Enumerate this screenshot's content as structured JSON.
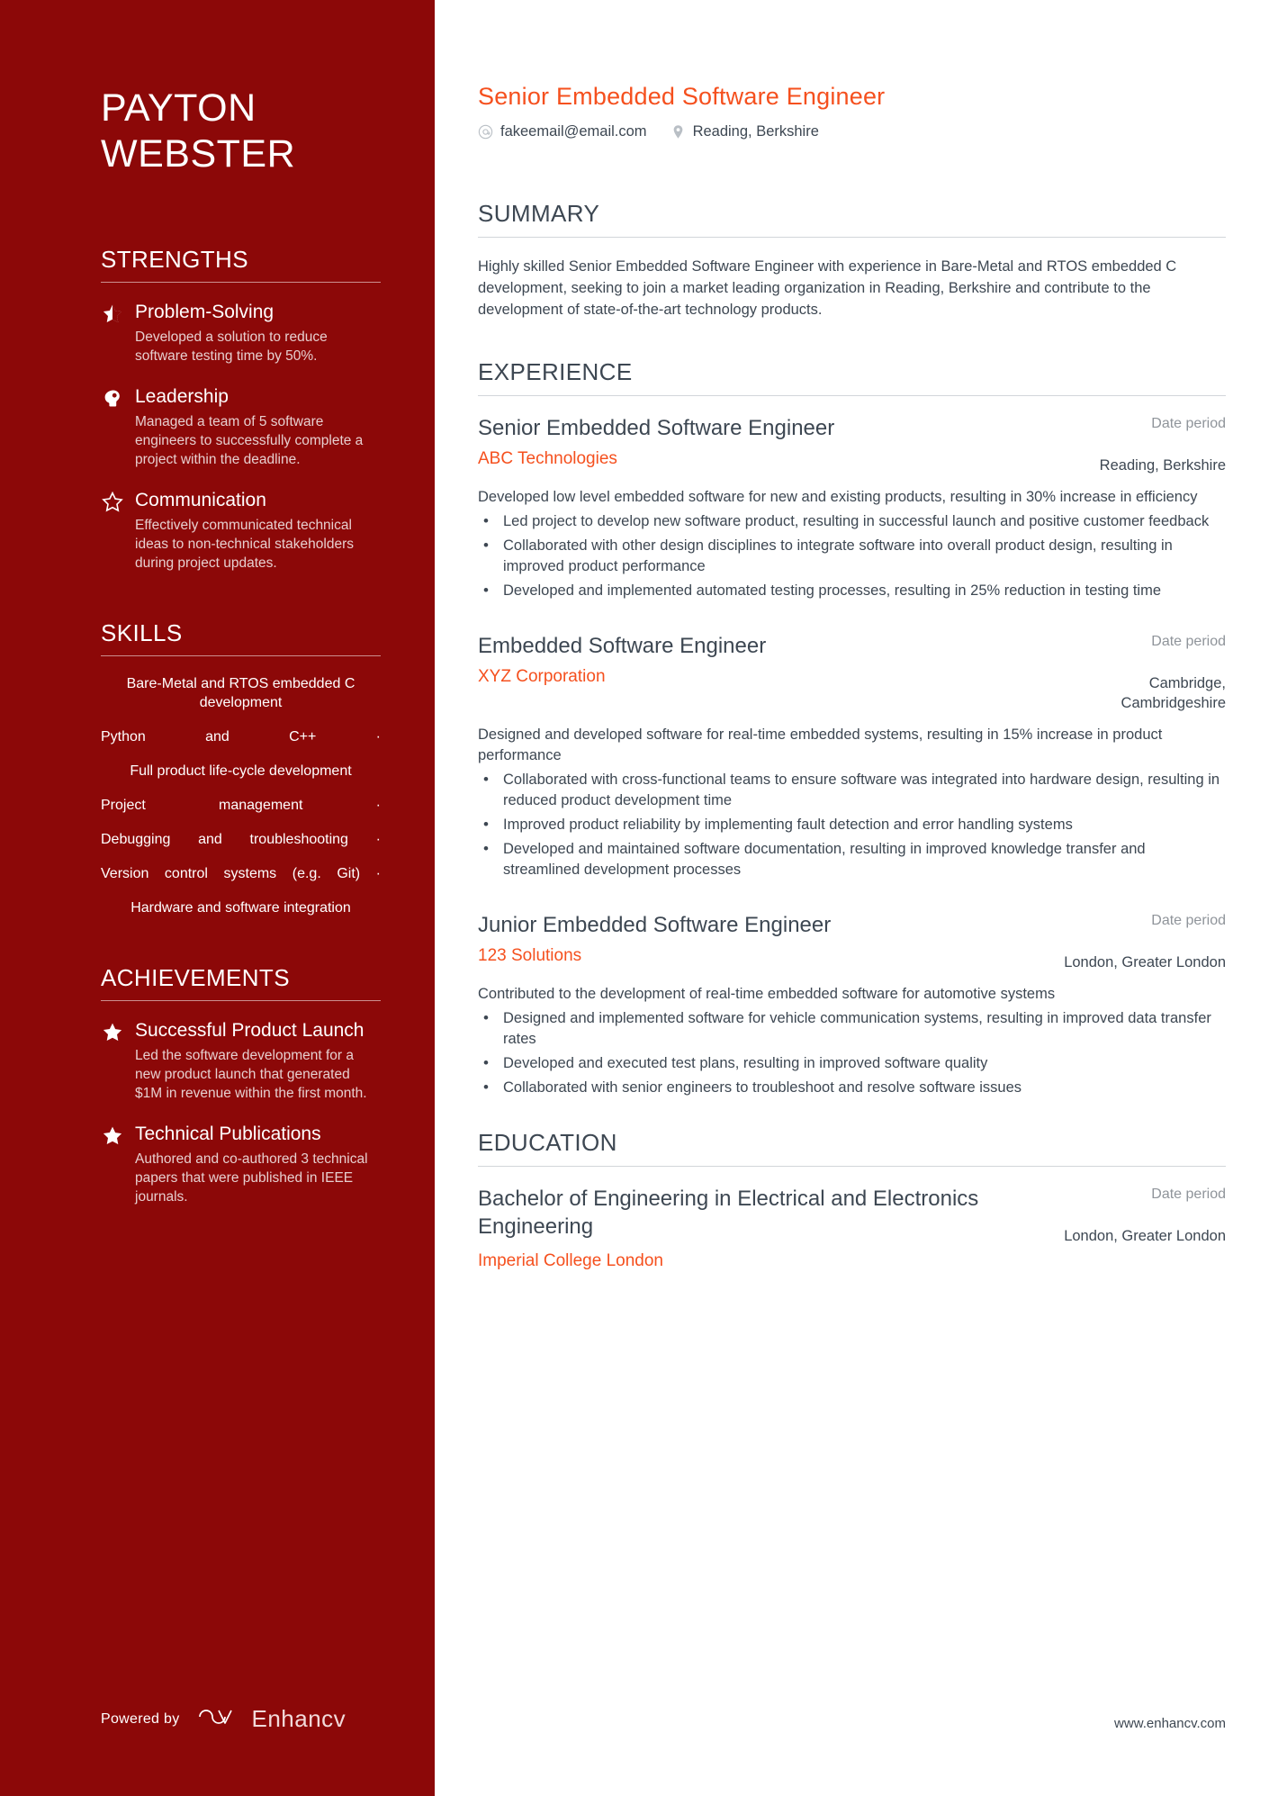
{
  "colors": {
    "sidebar_bg": "#8c0808",
    "accent_orange": "#f5501e",
    "body_text": "#3d4752",
    "muted_text": "#8f949a"
  },
  "sidebar": {
    "name_first": "PAYTON",
    "name_last": "WEBSTER",
    "strengths": {
      "heading": "STRENGTHS",
      "items": [
        {
          "icon": "star-half-icon",
          "title": "Problem-Solving",
          "description": "Developed a solution to reduce software testing time by 50%."
        },
        {
          "icon": "head-brain-icon",
          "title": "Leadership",
          "description": "Managed a team of 5 software engineers to successfully complete a project within the deadline."
        },
        {
          "icon": "star-outline-icon",
          "title": "Communication",
          "description": "Effectively communicated technical ideas to non-technical stakeholders during project updates."
        }
      ]
    },
    "skills": {
      "heading": "SKILLS",
      "items": [
        "Bare-Metal and RTOS embedded C development",
        "Python and C++",
        "Full product life-cycle development",
        "Project management",
        "Debugging and troubleshooting",
        "Version control systems (e.g. Git)",
        "Hardware and software integration"
      ]
    },
    "achievements": {
      "heading": "ACHIEVEMENTS",
      "items": [
        {
          "icon": "star-filled-icon",
          "title": "Successful Product Launch",
          "description": "Led the software development for a new product launch that generated $1M in revenue within the first month."
        },
        {
          "icon": "star-filled-icon",
          "title": "Technical Publications",
          "description": "Authored and co-authored 3 technical papers that were published in IEEE journals."
        }
      ]
    },
    "footer": {
      "powered_by": "Powered by",
      "brand": "Enhancv"
    }
  },
  "main": {
    "job_title": "Senior Embedded Software Engineer",
    "contacts": [
      {
        "icon": "at-email-icon",
        "text": "fakeemail@email.com"
      },
      {
        "icon": "map-pin-icon",
        "text": "Reading, Berkshire"
      }
    ],
    "summary": {
      "heading": "SUMMARY",
      "text": "Highly skilled Senior Embedded Software Engineer with experience in Bare-Metal and RTOS embedded C development, seeking to join a market leading organization in Reading, Berkshire and contribute to the development of state-of-the-art technology products."
    },
    "experience": {
      "heading": "EXPERIENCE",
      "entries": [
        {
          "role": "Senior Embedded Software Engineer",
          "company": "ABC Technologies",
          "date": "Date period",
          "location": "Reading, Berkshire",
          "description": "Developed low level embedded software for new and existing products, resulting in 30% increase in efficiency",
          "bullets": [
            "Led project to develop new software product, resulting in successful launch and positive customer feedback",
            "Collaborated with other design disciplines to integrate software into overall product design, resulting in improved product performance",
            "Developed and implemented automated testing processes, resulting in 25% reduction in testing time"
          ]
        },
        {
          "role": "Embedded Software Engineer",
          "company": "XYZ Corporation",
          "date": "Date period",
          "location": "Cambridge, Cambridgeshire",
          "description": "Designed and developed software for real-time embedded systems, resulting in 15% increase in product performance",
          "bullets": [
            "Collaborated with cross-functional teams to ensure software was integrated into hardware design, resulting in reduced product development time",
            "Improved product reliability by implementing fault detection and error handling systems",
            "Developed and maintained software documentation, resulting in improved knowledge transfer and streamlined development processes"
          ]
        },
        {
          "role": "Junior Embedded Software Engineer",
          "company": "123 Solutions",
          "date": "Date period",
          "location": "London, Greater London",
          "description": "Contributed to the development of real-time embedded software for automotive systems",
          "bullets": [
            "Designed and implemented software for vehicle communication systems, resulting in improved data transfer rates",
            "Developed and executed test plans, resulting in improved software quality",
            "Collaborated with senior engineers to troubleshoot and resolve software issues"
          ]
        }
      ]
    },
    "education": {
      "heading": "EDUCATION",
      "entries": [
        {
          "degree": "Bachelor of Engineering in Electrical and Electronics Engineering",
          "school": "Imperial College London",
          "date": "Date period",
          "location": "London, Greater London"
        }
      ]
    },
    "website": "www.enhancv.com"
  }
}
